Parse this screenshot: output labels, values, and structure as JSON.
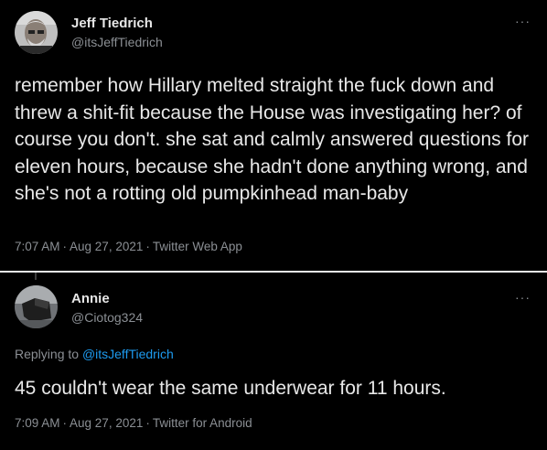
{
  "tweet1": {
    "name": "Jeff Tiedrich",
    "handle": "@itsJeffTiedrich",
    "text": "remember how Hillary melted straight the fuck down and threw a shit-fit because the House was investigating her? of course you don't. she sat and calmly answered questions for eleven hours, because she hadn't done anything wrong, and she's not a rotting old pumpkinhead man-baby",
    "time": "7:07 AM",
    "date": "Aug 27, 2021",
    "source": "Twitter Web App",
    "more_icon": "more-options-icon"
  },
  "tweet2": {
    "name": "Annie",
    "handle": "@Ciotog324",
    "replying_prefix": "Replying to",
    "replying_to": "@itsJeffTiedrich",
    "text": "45 couldn't wear the same underwear for 11 hours.",
    "time": "7:09 AM",
    "date": "Aug 27, 2021",
    "source": "Twitter for Android",
    "more_icon": "more-options-icon"
  },
  "separator": "·",
  "colors": {
    "background": "#000000",
    "text": "#e8e8e8",
    "secondary": "#8b8f94",
    "link": "#1d9bf0"
  }
}
